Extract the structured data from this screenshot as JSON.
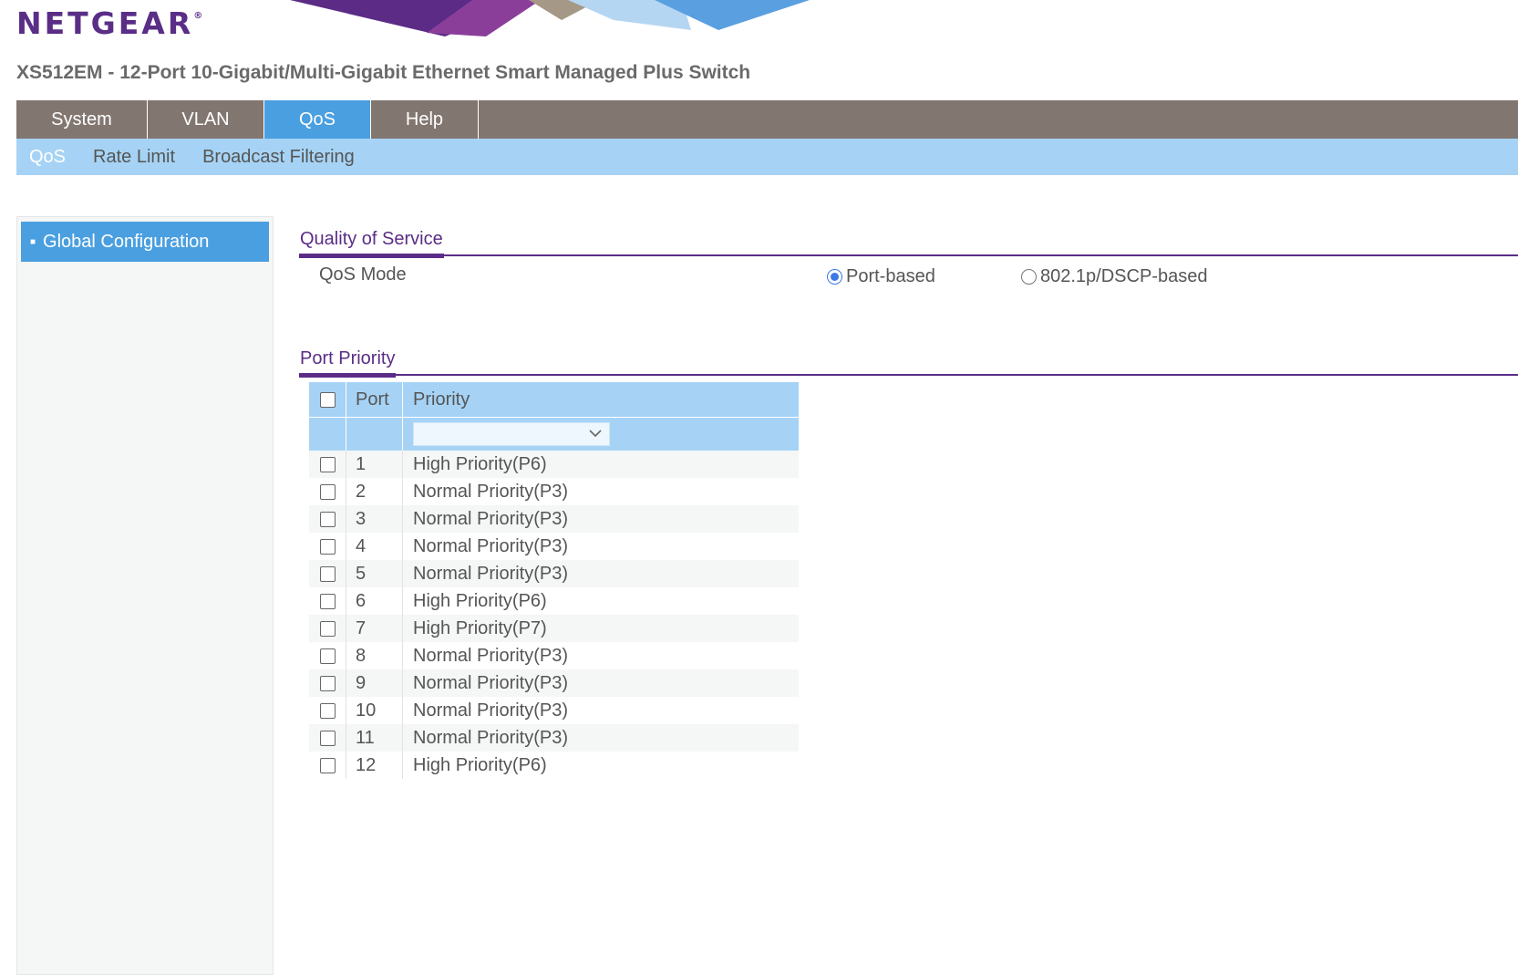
{
  "brand": {
    "logo_text": "NETGEAR",
    "logo_mark": "®",
    "accent": "#5a2d87"
  },
  "product_title": "XS512EM - 12-Port 10-Gigabit/Multi-Gigabit Ethernet Smart Managed Plus Switch",
  "main_nav": {
    "tabs": [
      {
        "label": "System",
        "active": false
      },
      {
        "label": "VLAN",
        "active": false
      },
      {
        "label": "QoS",
        "active": true
      },
      {
        "label": "Help",
        "active": false
      }
    ]
  },
  "sub_nav": {
    "items": [
      {
        "label": "QoS",
        "active": true
      },
      {
        "label": "Rate Limit",
        "active": false
      },
      {
        "label": "Broadcast Filtering",
        "active": false
      }
    ]
  },
  "sidebar": {
    "items": [
      {
        "label": "Global Configuration",
        "active": true
      }
    ]
  },
  "qos_section": {
    "title": "Quality of Service",
    "mode_label": "QoS Mode",
    "options": [
      {
        "label": "Port-based",
        "selected": true
      },
      {
        "label": "802.1p/DSCP-based",
        "selected": false
      }
    ]
  },
  "port_priority": {
    "title": "Port Priority",
    "columns": [
      "Port",
      "Priority"
    ],
    "filter_value": "",
    "rows": [
      {
        "port": "1",
        "priority": "High Priority(P6)"
      },
      {
        "port": "2",
        "priority": "Normal Priority(P3)"
      },
      {
        "port": "3",
        "priority": "Normal Priority(P3)"
      },
      {
        "port": "4",
        "priority": "Normal Priority(P3)"
      },
      {
        "port": "5",
        "priority": "Normal Priority(P3)"
      },
      {
        "port": "6",
        "priority": "High Priority(P6)"
      },
      {
        "port": "7",
        "priority": "High Priority(P7)"
      },
      {
        "port": "8",
        "priority": "Normal Priority(P3)"
      },
      {
        "port": "9",
        "priority": "Normal Priority(P3)"
      },
      {
        "port": "10",
        "priority": "Normal Priority(P3)"
      },
      {
        "port": "11",
        "priority": "Normal Priority(P3)"
      },
      {
        "port": "12",
        "priority": "High Priority(P6)"
      }
    ]
  },
  "colors": {
    "nav_bg": "#827671",
    "active_blue": "#4a9fe0",
    "sub_nav_bg": "#a6d3f5",
    "purple": "#5a2d87"
  }
}
